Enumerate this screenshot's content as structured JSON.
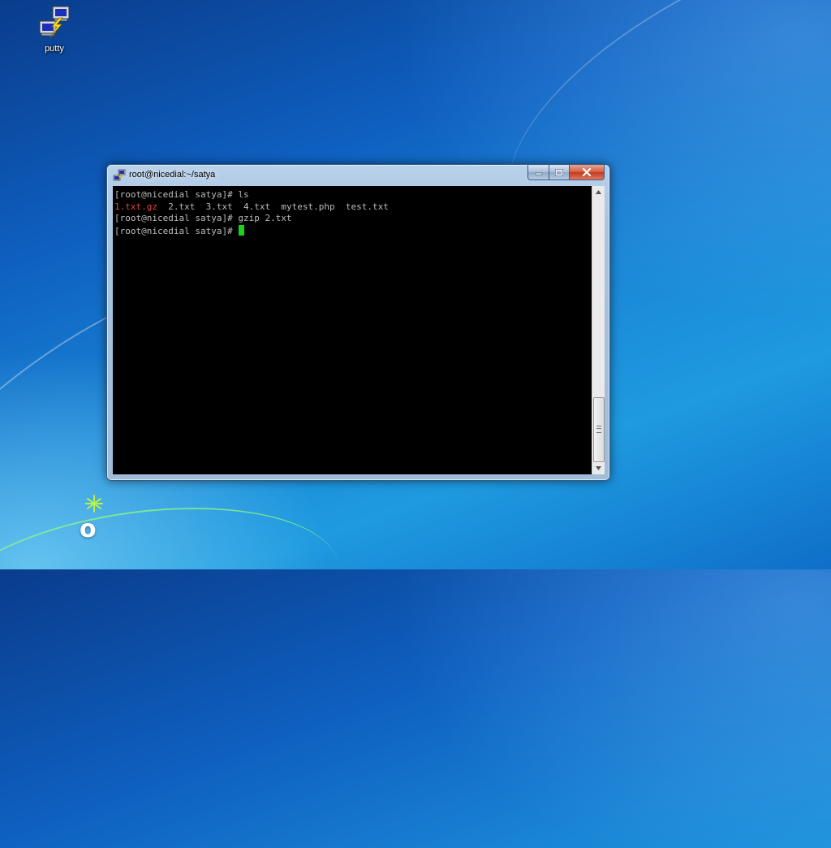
{
  "desktop": {
    "icons": [
      {
        "label": "putty",
        "icon": "putty-icon"
      }
    ]
  },
  "window": {
    "title": "root@nicedial:~/satya",
    "icon": "putty-icon",
    "controls": {
      "minimize_icon": "minimize-icon",
      "maximize_icon": "maximize-icon",
      "close_icon": "close-icon"
    }
  },
  "terminal": {
    "lines": [
      {
        "prompt": "[root@nicedial satya]# ",
        "command": "ls"
      },
      {
        "files": [
          {
            "name": "1.txt.gz",
            "color": "#e0433a"
          },
          {
            "name": "2.txt"
          },
          {
            "name": "3.txt"
          },
          {
            "name": "4.txt"
          },
          {
            "name": "mytest.php"
          },
          {
            "name": "test.txt"
          }
        ]
      },
      {
        "prompt": "[root@nicedial satya]# ",
        "command": "gzip 2.txt"
      },
      {
        "prompt": "[root@nicedial satya]# ",
        "command": ""
      }
    ],
    "cursor_color": "#19d219"
  },
  "scrollbar": {
    "position": 1.0
  },
  "logo": {
    "text": "o"
  }
}
